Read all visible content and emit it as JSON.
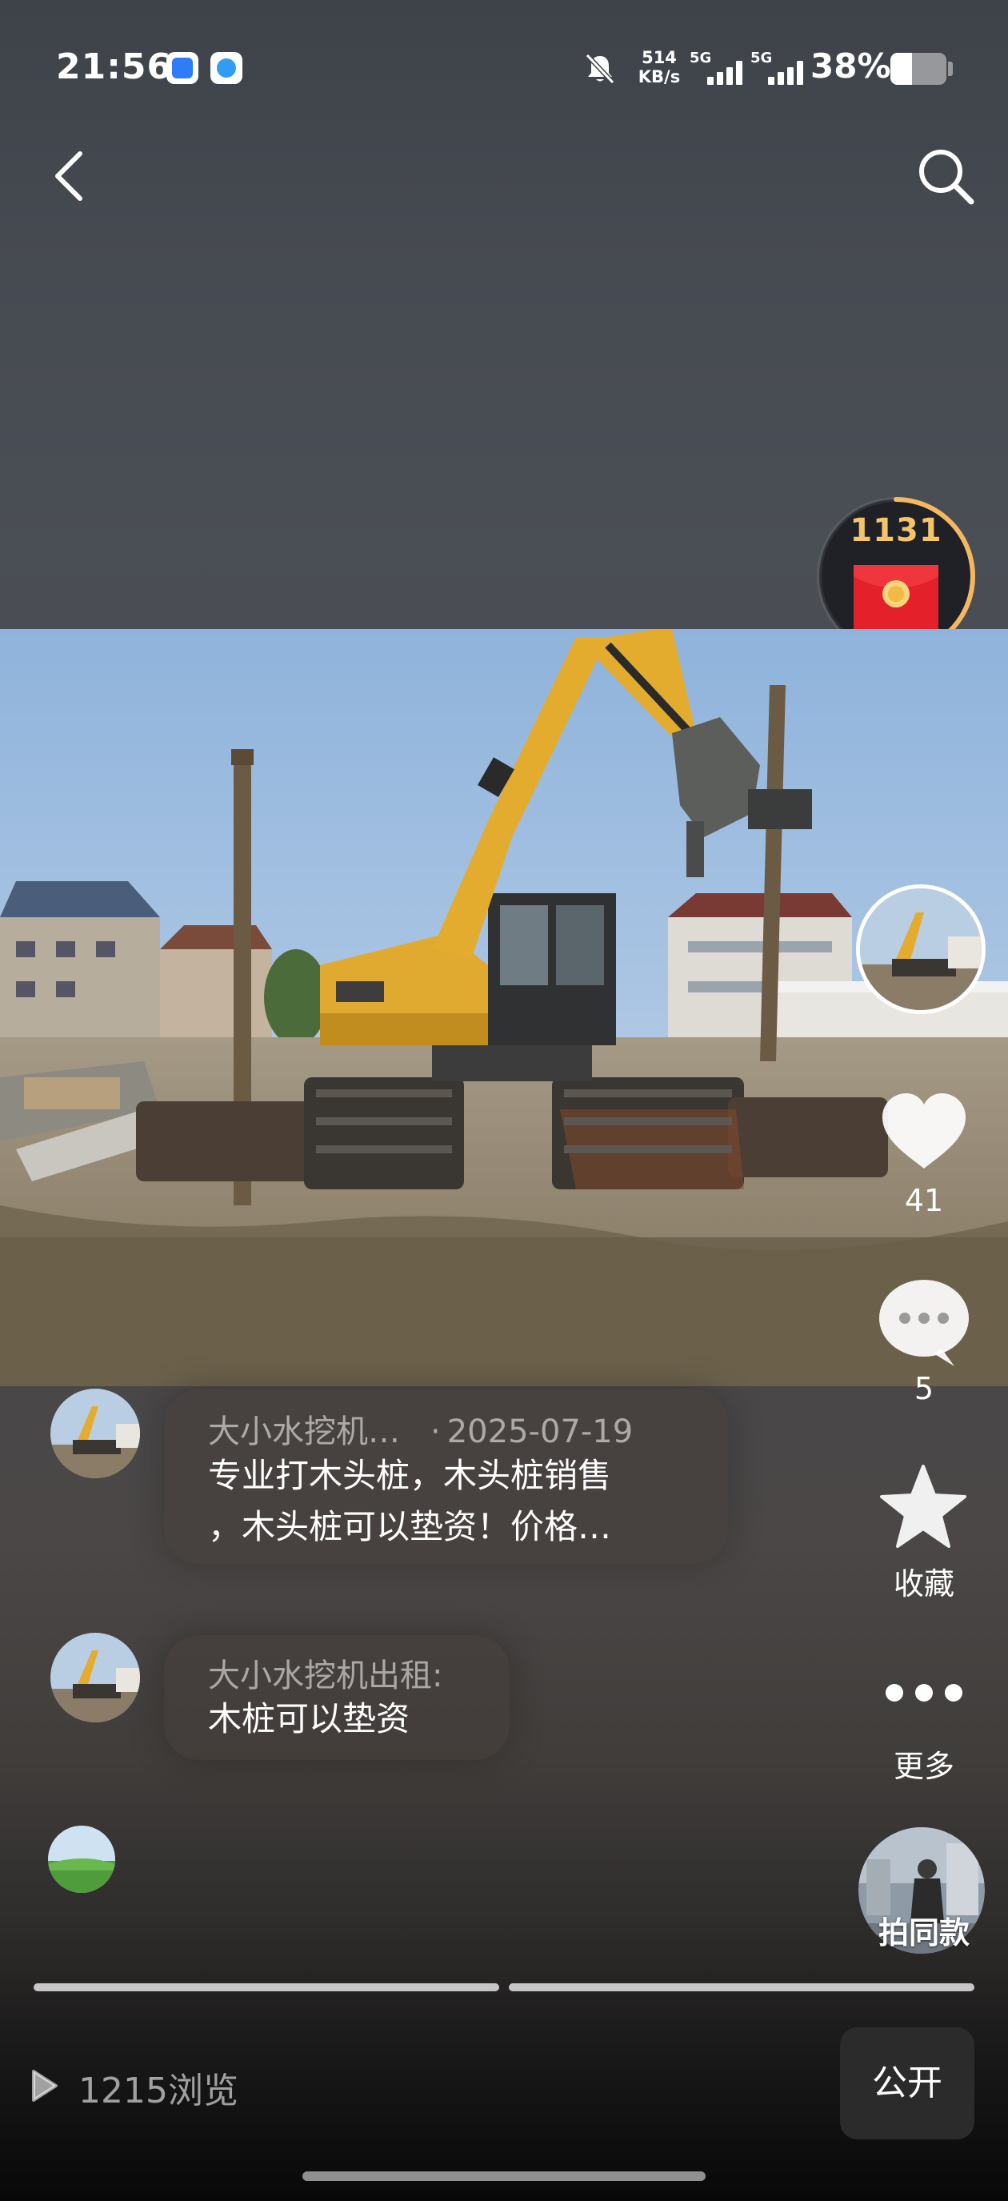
{
  "status_bar": {
    "time": "21:56",
    "net_speed_value": "514",
    "net_speed_unit": "KB/s",
    "network_1": "5G",
    "network_2": "5G",
    "battery_text": "38%",
    "battery_level": 0.38
  },
  "nav": {
    "back_icon": "chevron-left-icon",
    "search_icon": "search-icon"
  },
  "red_packet": {
    "count": "1131",
    "icon": "red-envelope-icon",
    "progress": 0.45,
    "ring_color": "#f4b860"
  },
  "photo": {
    "description_icon": "excavator-photo"
  },
  "actions": {
    "like_count": "41",
    "comment_count": "5",
    "collect_label": "收藏",
    "more_label": "更多",
    "same_style_label": "拍同款"
  },
  "comments": [
    {
      "author": "大小水挖机…",
      "date": "2025-07-19",
      "line1": "专业打木头桩，木头桩销售",
      "line2": "，木头桩可以垫资！价格…"
    },
    {
      "author": "大小水挖机出租:",
      "line1": "木桩可以垫资"
    }
  ],
  "bottom_bar": {
    "views_text": "1215浏览",
    "public_label": "公开"
  },
  "colors": {
    "accent_gold": "#f4c46a",
    "envelope_red": "#e4212b"
  }
}
